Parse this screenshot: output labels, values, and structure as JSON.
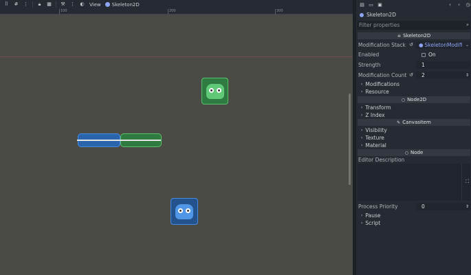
{
  "toolbar": {
    "view_label": "View",
    "node_label": "Skeleton2D"
  },
  "ruler": {
    "marks": [
      "100",
      "200",
      "300"
    ]
  },
  "inspector": {
    "node_name": "Skeleton2D",
    "filter_placeholder": "Filter properties",
    "class_skeleton": "Skeleton2D",
    "modification_stack_label": "Modification Stack",
    "modification_stack_value": "SkeletonModifi",
    "enabled_label": "Enabled",
    "enabled_value": "On",
    "strength_label": "Strength",
    "strength_value": "1",
    "mod_count_label": "Modification Count",
    "mod_count_value": "2",
    "modifications_group": "Modifications",
    "resource_group": "Resource",
    "class_node2d": "Node2D",
    "transform_group": "Transform",
    "zindex_group": "Z Index",
    "class_canvasitem": "CanvasItem",
    "visibility_group": "Visibility",
    "texture_group": "Texture",
    "material_group": "Material",
    "class_node": "Node",
    "editor_description_label": "Editor Description",
    "process_priority_label": "Process Priority",
    "process_priority_value": "0",
    "pause_group": "Pause",
    "script_group": "Script"
  },
  "colors": {
    "viewport_bg": "#4b4b45",
    "panel_bg": "#262b33",
    "accent": "#8da5f3",
    "sprite_green": "#3d8a4e",
    "sprite_blue": "#2c5f9e"
  }
}
